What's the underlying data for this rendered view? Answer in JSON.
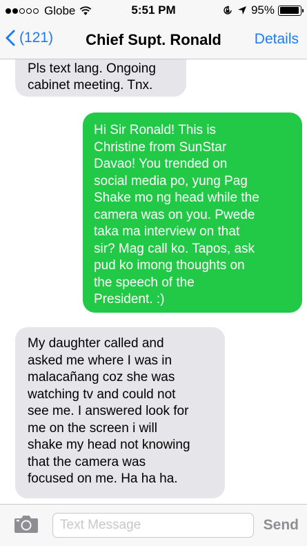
{
  "status_bar": {
    "carrier": "Globe",
    "time": "5:51 PM",
    "battery_percent": "95%",
    "battery_level": 0.95,
    "signal_bars_filled": 2,
    "signal_bars_total": 5,
    "icons": [
      "wifi-icon",
      "orientation-lock-icon",
      "location-arrow-icon",
      "battery-icon"
    ]
  },
  "nav": {
    "back_label": "(121)",
    "title": "Chief Supt. Ronald",
    "details_label": "Details",
    "accent_color": "#1a7cf5"
  },
  "messages": [
    {
      "direction": "received",
      "text": "Pls text lang. Ongoing\ncabinet meeting. Tnx."
    },
    {
      "direction": "sent",
      "text": "Hi Sir Ronald! This is\nChristine from SunStar\nDavao! You trended on\nsocial media po, yung Pag\nShake mo ng head while the\ncamera was on you. Pwede\ntaka ma interview on that\nsir? Mag call ko. Tapos, ask\npud ko imong thoughts on\nthe speech of the\nPresident. :)"
    },
    {
      "direction": "received",
      "text": "My daughter called and\nasked me where I was in\nmalacañang coz she was\nwatching tv and could not\nsee me. I answered look for\nme on the screen i will\nshake my head not knowing\nthat the camera was\nfocused on me. Ha ha ha."
    }
  ],
  "input_bar": {
    "placeholder": "Text Message",
    "send_label": "Send",
    "camera_icon": "camera-icon"
  },
  "colors": {
    "sent_bubble": "#22c947",
    "received_bubble": "#e5e5ea",
    "bar_background": "#f7f7f7"
  }
}
